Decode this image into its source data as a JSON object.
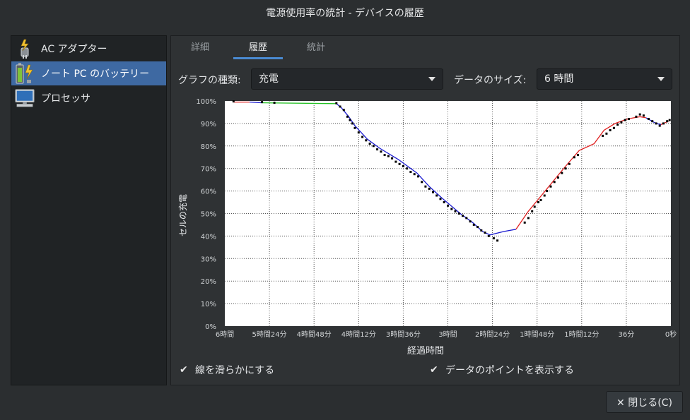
{
  "window": {
    "title": "電源使用率の統計 - デバイスの履歴"
  },
  "sidebar": {
    "items": [
      {
        "label": "AC アダプター",
        "icon": "ac-adapter-icon",
        "selected": false
      },
      {
        "label": "ノート PC のバッテリー",
        "icon": "battery-icon",
        "selected": true
      },
      {
        "label": "プロセッサ",
        "icon": "processor-icon",
        "selected": false
      }
    ]
  },
  "tabs": [
    {
      "label": "詳細",
      "active": false
    },
    {
      "label": "履歴",
      "active": true
    },
    {
      "label": "統計",
      "active": false
    }
  ],
  "controls": {
    "graph_type_label": "グラフの種類:",
    "graph_type_value": "充電",
    "data_size_label": "データのサイズ:",
    "data_size_value": "6 時間"
  },
  "options": {
    "smooth_label": "線を滑らかにする",
    "smooth_checked": true,
    "points_label": "データのポイントを表示する",
    "points_checked": true
  },
  "buttons": {
    "close_label": "✕ 閉じる(C)"
  },
  "chart_data": {
    "type": "line",
    "xlabel": "経過時間",
    "ylabel": "セルの充電",
    "x_ticks": [
      "6時間",
      "5時間24分",
      "4時間48分",
      "4時間12分",
      "3時間36分",
      "3時間",
      "2時間24分",
      "1時間48分",
      "1時間12分",
      "36分",
      "0秒"
    ],
    "y_ticks": [
      "0%",
      "10%",
      "20%",
      "30%",
      "40%",
      "50%",
      "60%",
      "70%",
      "80%",
      "90%",
      "100%"
    ],
    "xlim_minutes_ago": [
      360,
      0
    ],
    "ylim": [
      0,
      100
    ],
    "grid": true,
    "colors": {
      "charging": "#e02020",
      "full": "#22c022",
      "discharging": "#1a1ad0",
      "points": "#000000"
    },
    "segments": [
      {
        "state": "charging",
        "points": [
          [
            353,
            99.5
          ],
          [
            340,
            99.5
          ]
        ]
      },
      {
        "state": "discharging",
        "points": [
          [
            340,
            99.5
          ],
          [
            330,
            99.2
          ]
        ]
      },
      {
        "state": "full",
        "points": [
          [
            330,
            99.2
          ],
          [
            270,
            98.8
          ]
        ]
      },
      {
        "state": "discharging",
        "points": [
          [
            270,
            98.8
          ],
          [
            266,
            97
          ],
          [
            260,
            93
          ],
          [
            255,
            89
          ],
          [
            245,
            83
          ],
          [
            235,
            79
          ],
          [
            220,
            74
          ],
          [
            205,
            68
          ],
          [
            195,
            62
          ],
          [
            185,
            57
          ],
          [
            170,
            50
          ],
          [
            160,
            46
          ],
          [
            152,
            42
          ],
          [
            146,
            40.5
          ],
          [
            135,
            42
          ],
          [
            125,
            43
          ]
        ]
      },
      {
        "state": "charging",
        "points": [
          [
            125,
            43
          ],
          [
            115,
            51
          ],
          [
            100,
            61
          ],
          [
            85,
            71
          ],
          [
            74,
            78
          ],
          [
            62,
            81
          ],
          [
            54,
            87
          ],
          [
            45,
            90
          ],
          [
            35,
            92
          ],
          [
            25,
            93
          ],
          [
            20,
            92.5
          ]
        ]
      },
      {
        "state": "discharging",
        "points": [
          [
            20,
            92.5
          ],
          [
            12,
            90
          ],
          [
            8,
            89.5
          ]
        ]
      },
      {
        "state": "charging",
        "points": [
          [
            8,
            89.5
          ],
          [
            2,
            91
          ]
        ]
      }
    ],
    "scatter_points": [
      [
        353,
        99.8
      ],
      [
        330,
        99.5
      ],
      [
        320,
        99.2
      ],
      [
        270,
        99
      ],
      [
        267,
        97.5
      ],
      [
        264,
        96
      ],
      [
        261,
        93
      ],
      [
        259,
        91.5
      ],
      [
        257,
        90
      ],
      [
        255,
        88
      ],
      [
        252,
        86
      ],
      [
        249,
        84
      ],
      [
        246,
        82.5
      ],
      [
        243,
        81
      ],
      [
        240,
        80
      ],
      [
        237,
        78.5
      ],
      [
        234,
        77.5
      ],
      [
        231,
        76
      ],
      [
        228,
        75.5
      ],
      [
        225,
        74.5
      ],
      [
        222,
        73
      ],
      [
        219,
        72
      ],
      [
        216,
        71
      ],
      [
        213,
        70
      ],
      [
        210,
        68.5
      ],
      [
        207,
        67.5
      ],
      [
        204,
        66.5
      ],
      [
        201,
        64
      ],
      [
        198,
        62
      ],
      [
        195,
        61
      ],
      [
        192,
        59.5
      ],
      [
        189,
        58
      ],
      [
        186,
        56.5
      ],
      [
        183,
        55
      ],
      [
        180,
        53.5
      ],
      [
        177,
        52
      ],
      [
        174,
        51
      ],
      [
        171,
        50
      ],
      [
        168,
        49
      ],
      [
        165,
        48
      ],
      [
        162,
        46.5
      ],
      [
        159,
        45
      ],
      [
        156,
        44
      ],
      [
        153,
        42.5
      ],
      [
        150,
        41.5
      ],
      [
        147,
        40
      ],
      [
        143,
        39
      ],
      [
        140,
        38
      ],
      [
        118,
        46
      ],
      [
        115,
        48
      ],
      [
        112,
        51
      ],
      [
        110,
        53
      ],
      [
        107,
        55
      ],
      [
        105,
        56
      ],
      [
        102,
        58
      ],
      [
        100,
        60
      ],
      [
        97,
        62
      ],
      [
        94,
        64
      ],
      [
        91,
        66
      ],
      [
        88,
        68
      ],
      [
        85,
        70
      ],
      [
        82,
        72
      ],
      [
        78,
        75
      ],
      [
        75,
        76
      ],
      [
        55,
        84.5
      ],
      [
        52,
        85.5
      ],
      [
        49,
        87
      ],
      [
        46,
        88
      ],
      [
        43,
        89.5
      ],
      [
        40,
        90.5
      ],
      [
        37,
        91.5
      ],
      [
        34,
        92
      ],
      [
        28,
        93
      ],
      [
        25,
        94
      ],
      [
        22,
        93.5
      ],
      [
        18,
        92
      ],
      [
        15,
        91
      ],
      [
        12,
        90
      ],
      [
        9,
        89
      ],
      [
        6,
        90
      ],
      [
        3,
        91
      ],
      [
        1,
        91.5
      ]
    ]
  }
}
